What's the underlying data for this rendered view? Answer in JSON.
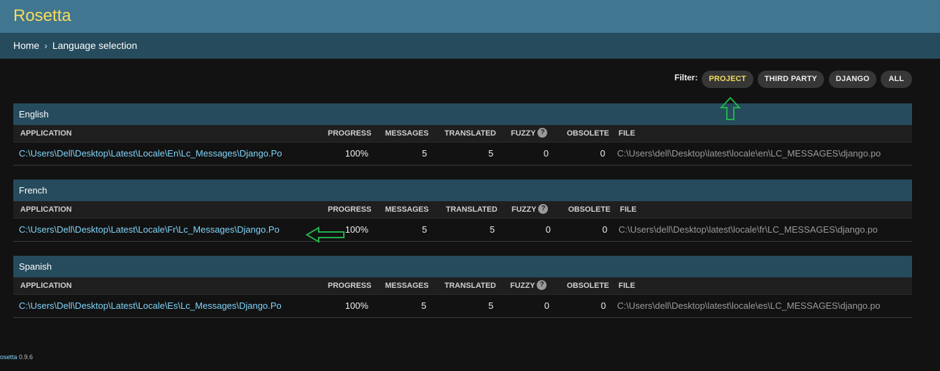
{
  "header": {
    "brand": "Rosetta"
  },
  "breadcrumbs": {
    "home": "Home",
    "separator": "›",
    "current": "Language selection"
  },
  "filter": {
    "label": "Filter:",
    "options": [
      {
        "label": "PROJECT",
        "active": true
      },
      {
        "label": "THIRD PARTY",
        "active": false
      },
      {
        "label": "DJANGO",
        "active": false
      },
      {
        "label": "ALL",
        "active": false
      }
    ]
  },
  "columns": {
    "application": "APPLICATION",
    "progress": "PROGRESS",
    "messages": "MESSAGES",
    "translated": "TRANSLATED",
    "fuzzy": "FUZZY",
    "fuzzy_help": "?",
    "obsolete": "OBSOLETE",
    "file": "FILE"
  },
  "languages": [
    {
      "name": "English",
      "rows": [
        {
          "application": "C:\\Users\\Dell\\Desktop\\Latest\\Locale\\En\\Lc_Messages\\Django.Po",
          "progress": "100%",
          "messages": "5",
          "translated": "5",
          "fuzzy": "0",
          "obsolete": "0",
          "file": "C:\\Users\\dell\\Desktop\\latest\\locale\\en\\LC_MESSAGES\\django.po"
        }
      ]
    },
    {
      "name": "French",
      "rows": [
        {
          "application": "C:\\Users\\Dell\\Desktop\\Latest\\Locale\\Fr\\Lc_Messages\\Django.Po",
          "progress": "100%",
          "messages": "5",
          "translated": "5",
          "fuzzy": "0",
          "obsolete": "0",
          "file": "C:\\Users\\dell\\Desktop\\latest\\locale\\fr\\LC_MESSAGES\\django.po"
        }
      ]
    },
    {
      "name": "Spanish",
      "rows": [
        {
          "application": "C:\\Users\\Dell\\Desktop\\Latest\\Locale\\Es\\Lc_Messages\\Django.Po",
          "progress": "100%",
          "messages": "5",
          "translated": "5",
          "fuzzy": "0",
          "obsolete": "0",
          "file": "C:\\Users\\dell\\Desktop\\latest\\locale\\es\\LC_MESSAGES\\django.po"
        }
      ]
    }
  ],
  "footer": {
    "link": "osetta",
    "version": "0.9.6"
  },
  "colors": {
    "header_bg": "#417690",
    "breadcrumb_bg": "#264b5d",
    "brand": "#f5dd5d",
    "link": "#81d4fa",
    "annotation_arrow": "#22b14c"
  }
}
